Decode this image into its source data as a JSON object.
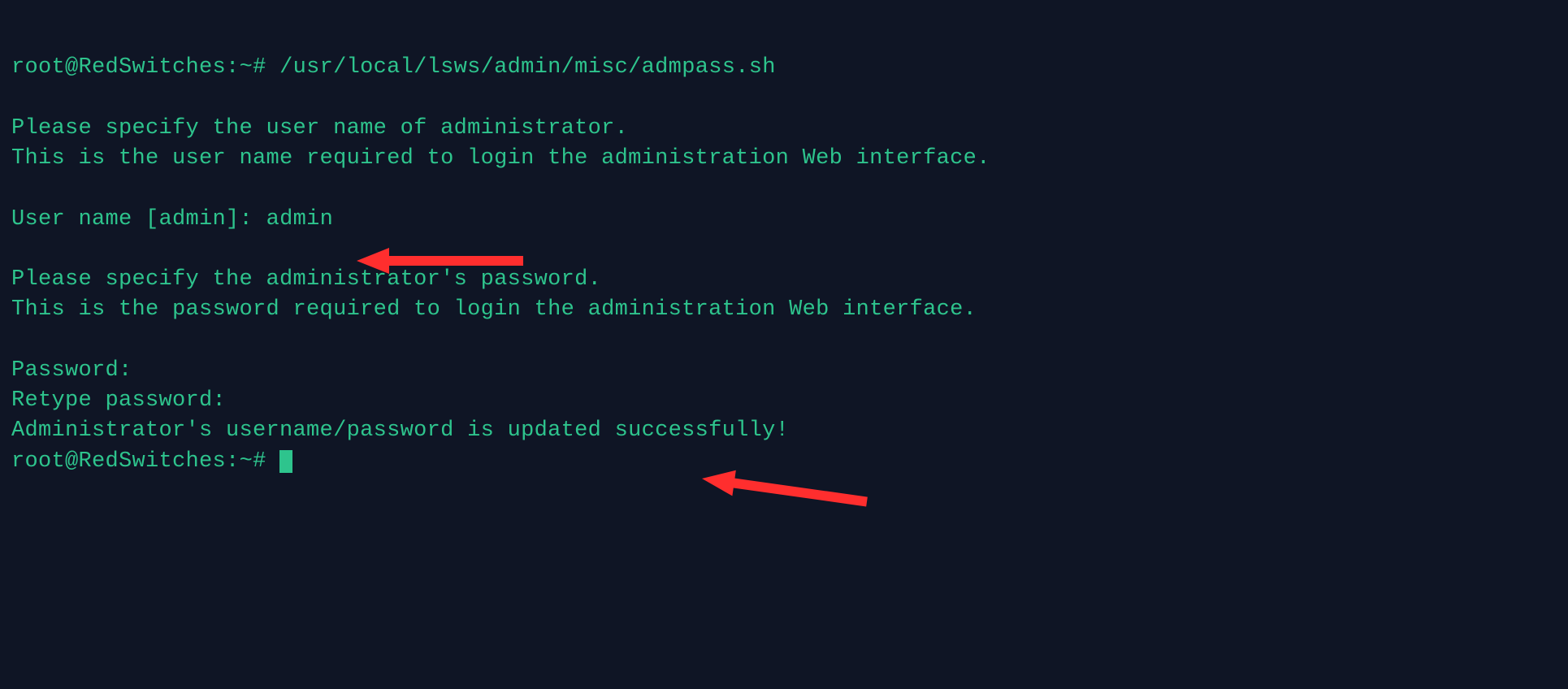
{
  "prompt1": {
    "user_host": "root@RedSwitches",
    "sep": ":",
    "path": "~",
    "hash": "#",
    "command": "/usr/local/lsws/admin/misc/admpass.sh"
  },
  "output": {
    "line1": "",
    "line2": "Please specify the user name of administrator.",
    "line3": "This is the user name required to login the administration Web interface.",
    "line4": "",
    "username_prompt_label": "User name [admin]: ",
    "username_value": "admin",
    "line6": "",
    "line7": "Please specify the administrator's password.",
    "line8": "This is the password required to login the administration Web interface.",
    "line9": "",
    "password_prompt": "Password:",
    "retype_prompt": "Retype password:",
    "success": "Administrator's username/password is updated successfully!"
  },
  "prompt2": {
    "user_host": "root@RedSwitches",
    "sep": ":",
    "path": "~",
    "hash": "#"
  },
  "annotations": {
    "arrow1": "red-arrow-pointing-left",
    "arrow2": "red-arrow-pointing-left"
  },
  "colors": {
    "background": "#0f1525",
    "text": "#2ec48d",
    "arrow": "#ff2e2e"
  }
}
